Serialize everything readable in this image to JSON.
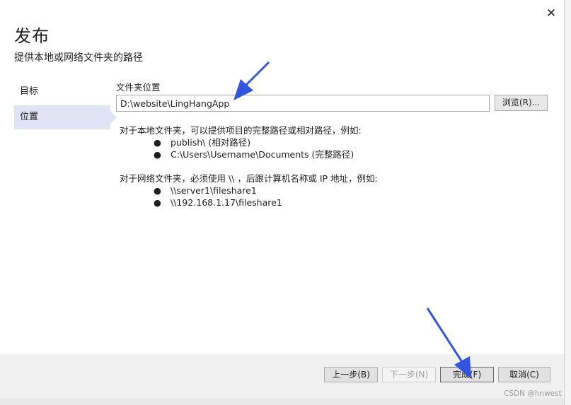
{
  "dialog": {
    "title": "发布",
    "subtitle": "提供本地或网络文件夹的路径",
    "close_glyph": "✕"
  },
  "sidebar": {
    "items": [
      {
        "label": "目标",
        "selected": false
      },
      {
        "label": "位置",
        "selected": true
      }
    ]
  },
  "location": {
    "folder_label": "文件夹位置",
    "path_value": "D:\\website\\LingHangApp",
    "browse_label": "浏览(R)..."
  },
  "help": {
    "local_intro": "对于本地文件夹，可以提供项目的完整路径或相对路径，例如:",
    "local_examples": [
      "publish\\ (相对路径)",
      "C:\\Users\\Username\\Documents (完整路径)"
    ],
    "network_intro": "对于网络文件夹，必须使用 \\\\ ，后跟计算机名称或 IP 地址，例如:",
    "network_examples": [
      "\\\\server1\\fileshare1",
      "\\\\192.168.1.17\\fileshare1"
    ],
    "bullet": "●"
  },
  "footer": {
    "prev_label": "上一步(B)",
    "next_label": "下一步(N)",
    "finish_label": "完成(F)",
    "cancel_label": "取消(C)"
  },
  "watermark": "CSDN @hnwest",
  "colors": {
    "sidebar_selected": "#dfe3f3",
    "footer_bg": "#f0f0f0",
    "annotation_arrow": "#3355dd"
  }
}
